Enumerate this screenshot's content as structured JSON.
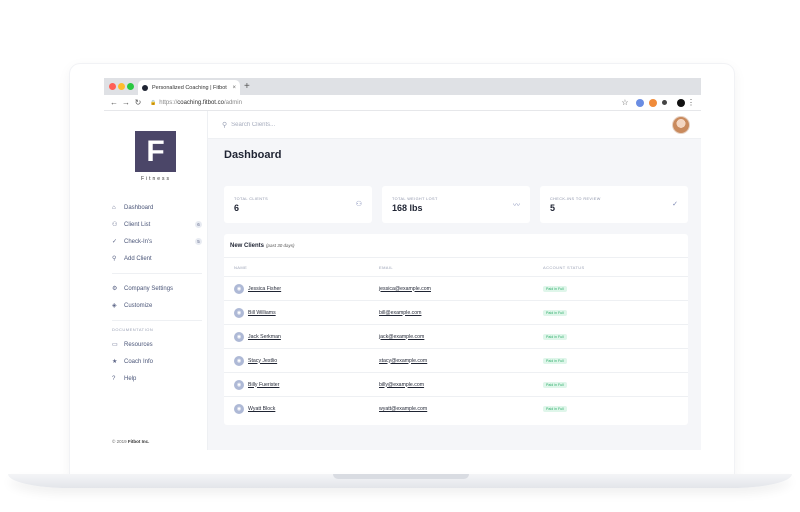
{
  "browser": {
    "tab_title": "Personalized Coaching | Fitbot",
    "tab_close": "×",
    "new_tab": "+",
    "url_prefix": "https://",
    "url_domain": "coaching.fitbot.co",
    "url_path": "/admin"
  },
  "sidebar": {
    "logo_letter": "F",
    "logo_sub": "Fitness",
    "items": [
      {
        "label": "Dashboard",
        "icon": "dashboard-icon",
        "glyph": "⌂"
      },
      {
        "label": "Client List",
        "icon": "users-icon",
        "glyph": "⚇",
        "count": "6"
      },
      {
        "label": "Check-In's",
        "icon": "check-icon",
        "glyph": "✓",
        "count": "5"
      },
      {
        "label": "Add Client",
        "icon": "user-plus-icon",
        "glyph": "⚲"
      }
    ],
    "settings_items": [
      {
        "label": "Company Settings",
        "icon": "gear-icon",
        "glyph": "⚙"
      },
      {
        "label": "Customize",
        "icon": "layers-icon",
        "glyph": "◈"
      }
    ],
    "section_label": "DOCUMENTATION",
    "doc_items": [
      {
        "label": "Resources",
        "icon": "book-icon",
        "glyph": "▭"
      },
      {
        "label": "Coach Info",
        "icon": "star-icon",
        "glyph": "★"
      },
      {
        "label": "Help",
        "icon": "help-icon",
        "glyph": "?"
      }
    ],
    "footer_prefix": "© 2019",
    "footer_brand": "Fitbot Inc."
  },
  "search": {
    "placeholder": "Search Clients..."
  },
  "page_title": "Dashboard",
  "stats": [
    {
      "label": "TOTAL CLIENTS",
      "value": "6",
      "icon": "users-icon",
      "glyph": "⚇"
    },
    {
      "label": "TOTAL WEIGHT LOST",
      "value": "168 lbs",
      "icon": "trend-icon",
      "glyph": "〰"
    },
    {
      "label": "CHECK-INS TO REVIEW",
      "value": "5",
      "icon": "check-circle-icon",
      "glyph": "✓"
    }
  ],
  "new_clients": {
    "title": "New Clients",
    "subtitle": "(past 30 days)",
    "columns": [
      "NAME",
      "EMAIL",
      "ACCOUNT STATUS"
    ],
    "rows": [
      {
        "name": "Jessica Fisher",
        "email": "jessica@example.com",
        "status": "Paid in Full"
      },
      {
        "name": "Bill Williams",
        "email": "bill@example.com",
        "status": "Paid in Full"
      },
      {
        "name": "Jack Serkman",
        "email": "jack@example.com",
        "status": "Paid in Full"
      },
      {
        "name": "Stacy Jestlio",
        "email": "stacy@example.com",
        "status": "Paid in Full"
      },
      {
        "name": "Billy Fuerister",
        "email": "billy@example.com",
        "status": "Paid in Full"
      },
      {
        "name": "Wyatt Block",
        "email": "wyatt@example.com",
        "status": "Paid in Full"
      }
    ]
  }
}
